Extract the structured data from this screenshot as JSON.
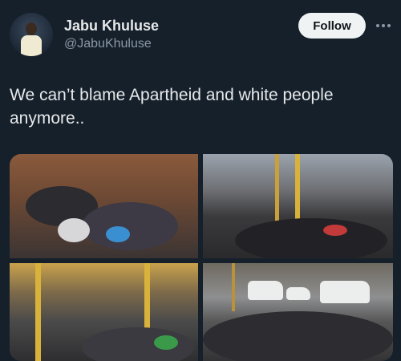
{
  "author": {
    "name": "Jabu Khuluse",
    "handle": "@JabuKhuluse"
  },
  "actions": {
    "follow_label": "Follow",
    "more_icon": "more-horizontal-icon"
  },
  "tweet": {
    "text": "We can’t blame Apartheid and white people anymore.."
  },
  "colors": {
    "background": "#15202b",
    "text": "#e7e9ea",
    "secondary_text": "#8b98a5",
    "follow_button": "#eff3f4"
  }
}
